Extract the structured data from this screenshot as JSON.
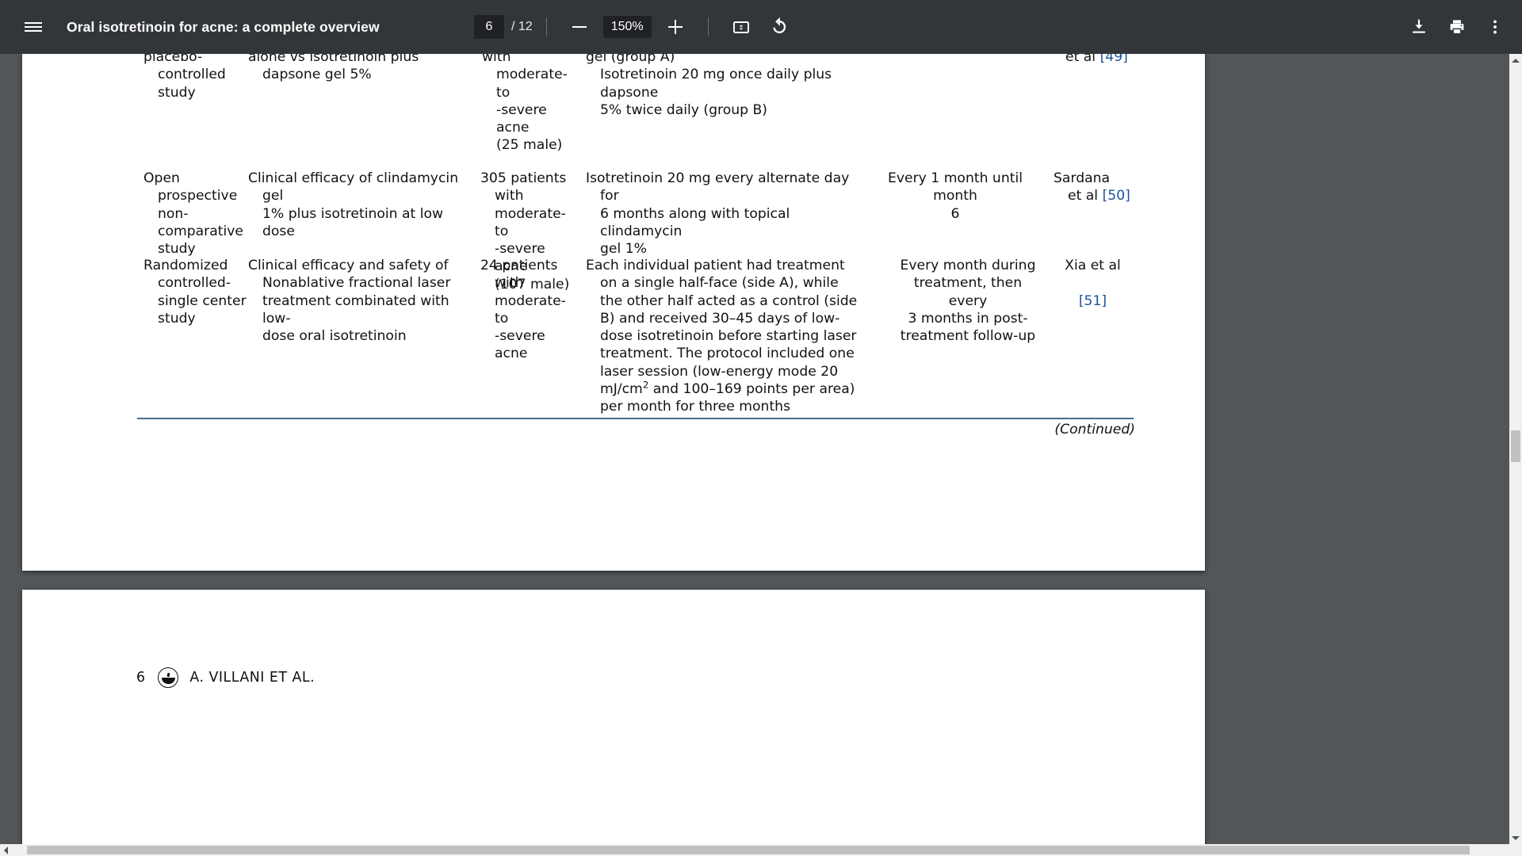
{
  "toolbar": {
    "menu_icon": "hamburger-menu-icon",
    "title": "Oral isotretinoin for acne: a complete overview",
    "page_current": "6",
    "page_total": "/ 12",
    "zoom_out_icon": "minus-icon",
    "zoom_level": "150%",
    "zoom_in_icon": "plus-icon",
    "fit_icon": "fit-to-page-icon",
    "rotate_icon": "rotate-counterclockwise-icon",
    "download_icon": "download-icon",
    "print_icon": "print-icon",
    "more_icon": "more-vertical-icon"
  },
  "document": {
    "page6": {
      "rows": [
        {
          "design": "placebo-\ncontrolled\nstudy",
          "aim": "alone vs isotretinoin plus\ndapsone gel 5%",
          "patients": "with\nmoderate-to\n-severe acne\n(25 male)",
          "treatment": "gel (group A)\nIsotretinoin 20 mg once daily plus dapsone\n5% twice daily (group B)",
          "followup": "",
          "reference": "et al ",
          "reference_link": "[49]"
        },
        {
          "design": "Open\nprospective\nnon-\ncomparative\nstudy",
          "aim": "Clinical efficacy of clindamycin gel\n1% plus isotretinoin at low dose",
          "patients": "305 patients\nwith\nmoderate-to\n-severe acne\n(107 male)",
          "treatment": "Isotretinoin 20 mg every alternate day for\n6 months along with topical clindamycin\ngel 1%",
          "followup": "Every 1 month until month\n6",
          "reference": "Sardana\net al ",
          "reference_link": "[50]"
        },
        {
          "design": "Randomized\ncontrolled-\nsingle center\nstudy",
          "aim": "Clinical efficacy and safety of\nNonablative fractional laser\ntreatment combinated with low-\ndose oral isotretinoin",
          "patients": "24 patients\nwith\nmoderate-to\n-severe acne",
          "treatment": "Each individual patient had treatment on a single half-face (side A), while the other half acted as a control (side B) and received 30–45 days of low-dose isotretinoin before starting laser treatment. The protocol included one laser session (low-energy mode 20 mJ/cm2 and 100–169 points per area) per month for three months",
          "followup": "Every month during\ntreatment, then every\n3 months in post-\ntreatment follow-up",
          "reference": "Xia et al\n",
          "reference_link": "[51]"
        }
      ],
      "continued_note": "(Continued)",
      "link_color": "#19529c"
    },
    "page7": {
      "footer_page_number": "6",
      "footer_logo": "journal-logo-icon",
      "footer_authors": "A. VILLANI ET AL."
    }
  },
  "scrollbars": {
    "vertical_up_icon": "triangle-up-icon",
    "vertical_down_icon": "triangle-down-icon",
    "horizontal_left_icon": "triangle-left-icon",
    "horizontal_right_icon": "triangle-right-icon"
  }
}
